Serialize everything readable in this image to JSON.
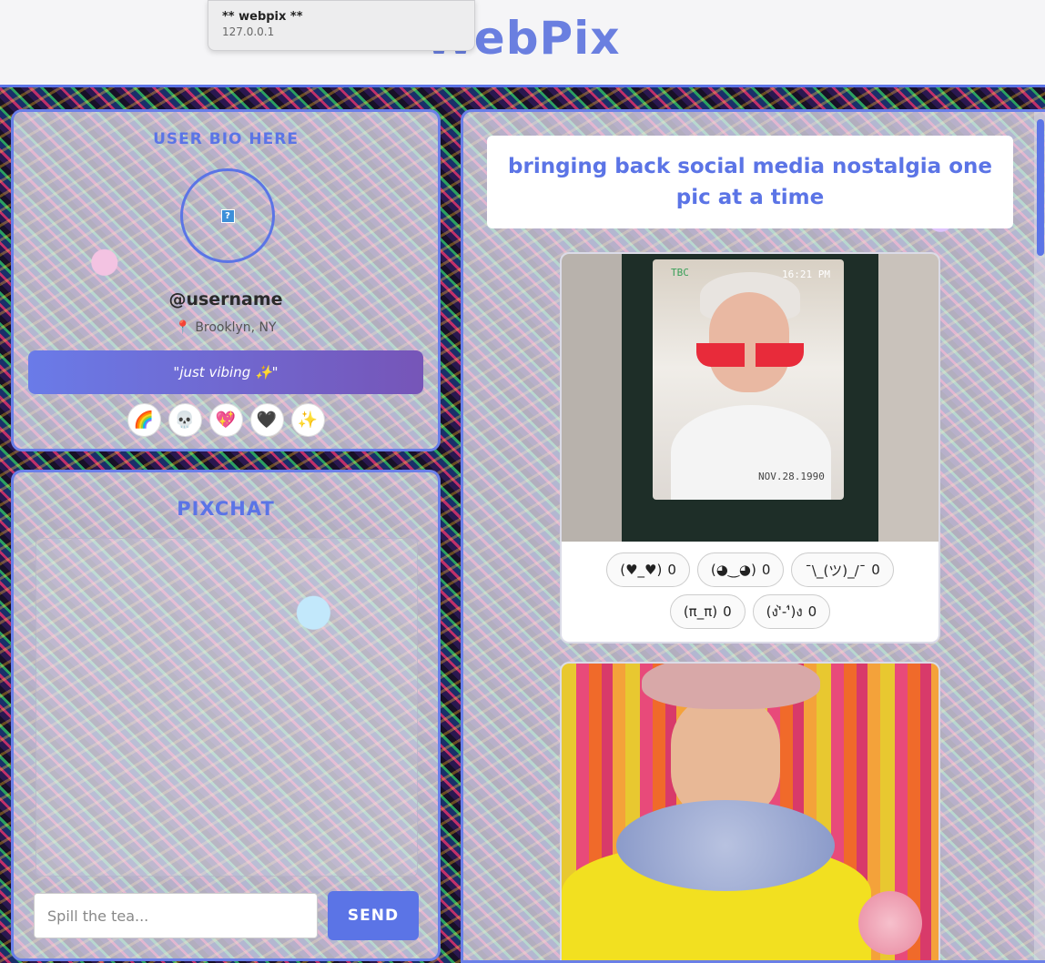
{
  "browser": {
    "tooltip_title": "** webpix **",
    "tooltip_url": "127.0.0.1"
  },
  "header": {
    "logo": "WebPix"
  },
  "bio": {
    "title": "USER BIO HERE",
    "avatar_placeholder": "?",
    "username": "@username",
    "location_icon": "📍",
    "location": "Brooklyn, NY",
    "vibe": "\"just vibing ✨\"",
    "emojis": [
      "🌈",
      "💀",
      "💖",
      "🖤",
      "✨"
    ]
  },
  "chat": {
    "title": "PIXCHAT",
    "input_placeholder": "Spill the tea...",
    "send_label": "SEND"
  },
  "feed": {
    "tagline": "bringing back social media nostalgia one pic at a time",
    "posts": [
      {
        "photo_caption_time": "16:21 PM",
        "photo_caption_date": "NOV.28.1990",
        "photo_caption_brand": "TBC",
        "reactions": [
          {
            "face": "(♥_♥)",
            "count": "0"
          },
          {
            "face": "(◕‿◕)",
            "count": "0"
          },
          {
            "face": "¯\\_(ツ)_/¯",
            "count": "0"
          },
          {
            "face": "(π_π)",
            "count": "0"
          },
          {
            "face": "(ง'̀-'́)ง",
            "count": "0"
          }
        ]
      },
      {
        "reactions": []
      }
    ]
  }
}
